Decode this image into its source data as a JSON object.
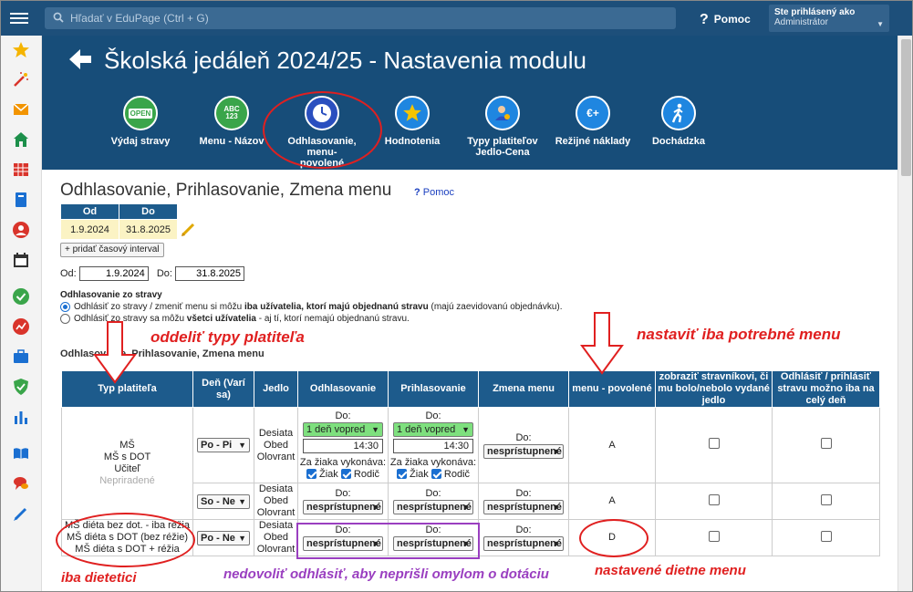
{
  "topbar": {
    "search_placeholder": "Hľadať v EduPage (Ctrl + G)",
    "help_label": "Pomoc",
    "user_line1": "Ste prihlásený ako",
    "user_line2": "Administrátor"
  },
  "header": {
    "title": "Školská jedáleň 2024/25 - Nastavenia modulu",
    "tiles": [
      {
        "label": "Výdaj stravy",
        "icon": "open-sign-icon",
        "color": "#3aa54a"
      },
      {
        "label": "Menu - Názov",
        "icon": "abc-123-icon",
        "color": "#3aa54a"
      },
      {
        "label": "Odhlasovanie, menu-povolené",
        "icon": "clock-icon",
        "color": "#2a4fbf"
      },
      {
        "label": "Hodnotenia",
        "icon": "star-icon",
        "color": "#1f86e0"
      },
      {
        "label": "Typy platiteľov Jedlo-Cena",
        "icon": "person-coins-icon",
        "color": "#1f86e0"
      },
      {
        "label": "Režijné náklady",
        "icon": "euro-plus-icon",
        "color": "#1f86e0"
      },
      {
        "label": "Dochádzka",
        "icon": "walking-person-icon",
        "color": "#1f86e0"
      }
    ]
  },
  "content": {
    "section_title": "Odhlasovanie, Prihlasovanie, Zmena menu",
    "pomoc_q": "?",
    "pomoc_label": "Pomoc",
    "interval_headers": [
      "Od",
      "Do"
    ],
    "interval_row": [
      "1.9.2024",
      "31.8.2025"
    ],
    "add_interval_label": "+ pridať časový interval",
    "od_label": "Od:",
    "od_value": "1.9.2024",
    "do_label": "Do:",
    "do_value": "31.8.2025",
    "odh_heading": "Odhlasovanie zo stravy",
    "radio1_pre": "Odhlásiť zo stravy / zmeniť menu si môžu ",
    "radio1_bold": "iba užívatelia, ktorí majú objednanú stravu",
    "radio1_post": " (majú zaevidovanú objednávku).",
    "radio2_pre": "Odhlásiť zo stravy sa môžu ",
    "radio2_bold": "všetci užívatelia",
    "radio2_post": " - aj tí, ktorí nemajú objednanú stravu.",
    "sub_caption": "Odhlasovanie, Prihlasovanie, Zmena menu"
  },
  "grid": {
    "headers": [
      "Typ platiteľa",
      "Deň (Varí sa)",
      "Jedlo",
      "Odhlasovanie",
      "Prihlasovanie",
      "Zmena menu",
      "menu - povolené",
      "zobraziť stravníkovi, či mu bolo/nebolo vydané jedlo",
      "Odhlásiť / prihlásiť stravu možno iba na celý deň"
    ],
    "group1_types": [
      "MŠ",
      "MŠ s DOT",
      "Učiteľ"
    ],
    "group1_unassigned": "Nepriradené",
    "group2_types": [
      "MŠ diéta bez dot. - iba réžia",
      "MŠ diéta s DOT (bez réžie)",
      "MŠ diéta s DOT + réžia"
    ],
    "days_row1": "Po - Pi",
    "days_row2": "So - Ne",
    "days_row3": "Po - Ne",
    "meals": [
      "Desiata",
      "Obed",
      "Olovrant"
    ],
    "do_label": "Do:",
    "vopred": "1 deň vopred",
    "time": "14:30",
    "za_ziaka": "Za žiaka vykonáva:",
    "ziak": "Žiak",
    "rodic": "Rodič",
    "nesp": "nesprístupnené",
    "menu_values": [
      "A",
      "A",
      "D"
    ]
  },
  "annotations": {
    "oddelit": "oddeliť typy platiteľa",
    "nastavit": "nastaviť iba potrebné menu",
    "dietetici": "iba dietetici",
    "nedovolit": "nedovoliť odhlásiť, aby neprišli omylom o dotáciu",
    "dietne": "nastavené dietne menu"
  },
  "colors": {
    "topbar": "#1d4f7a",
    "header": "#174d79",
    "table_header": "#1d5b8c",
    "annotation_red": "#e02020",
    "annotation_purple": "#9a3fc0",
    "select_green": "#7ee07e"
  }
}
